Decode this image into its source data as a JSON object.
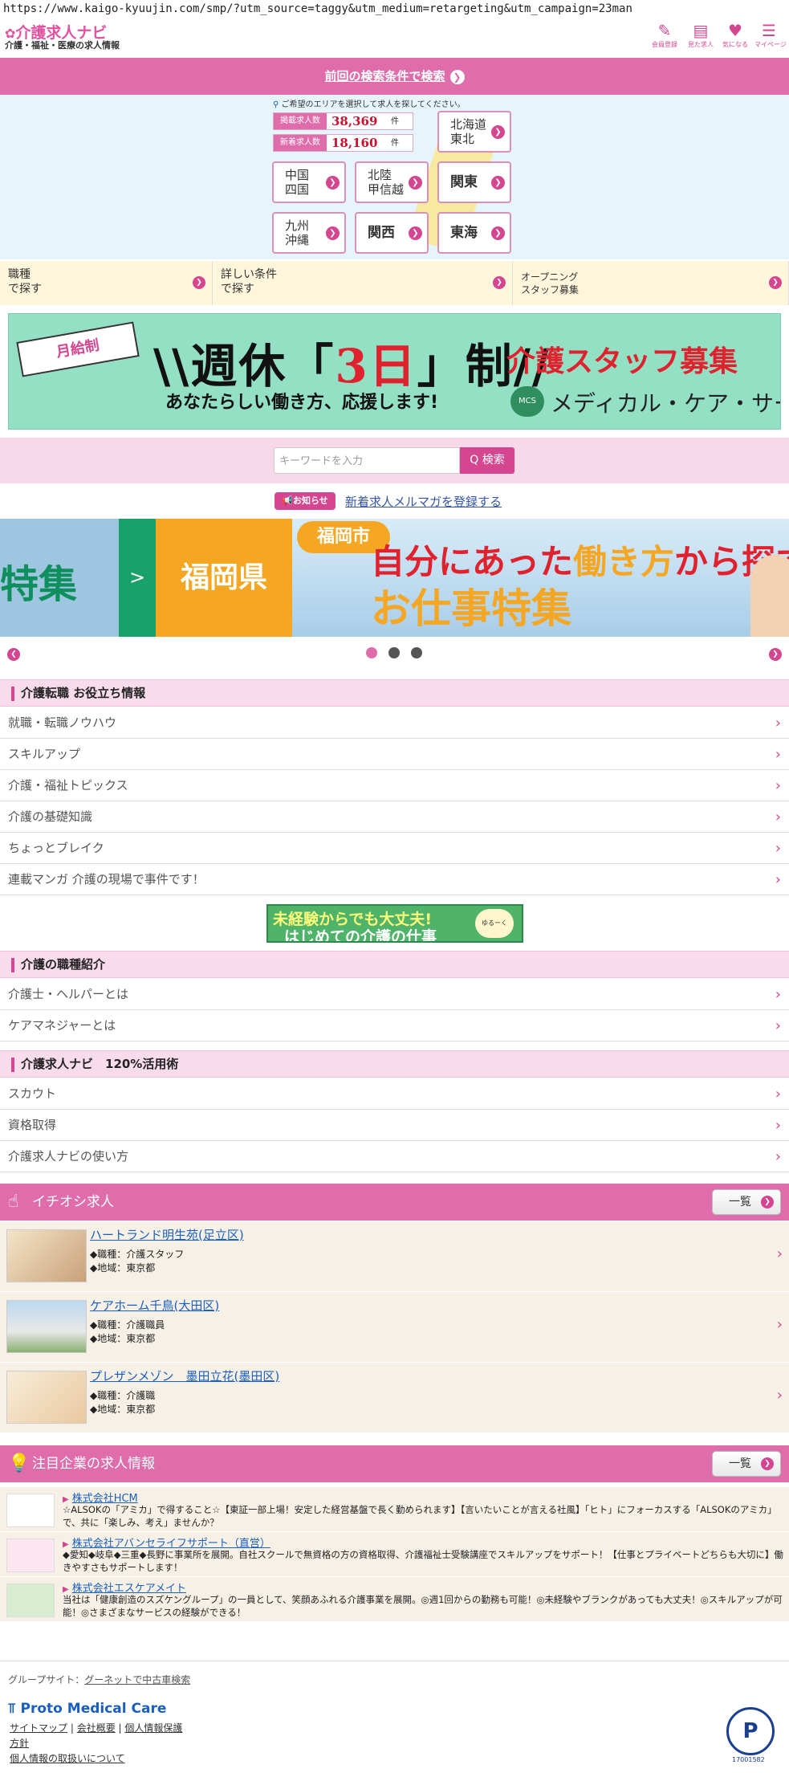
{
  "url": "https://www.kaigo-kyuujin.com/smp/?utm_source=taggy&utm_medium=retargeting&utm_campaign=23man",
  "header": {
    "logo_title": "介護求人ナビ",
    "logo_sub": "介護・福祉・医療の求人情報",
    "icons": [
      {
        "icon": "pencil-icon",
        "label": "会員登録"
      },
      {
        "icon": "history-icon",
        "label": "見た求人"
      },
      {
        "icon": "heart-icon",
        "label": "気になる"
      },
      {
        "icon": "mypage-icon",
        "label": "マイページ"
      }
    ]
  },
  "prev_search": "前回の検索条件で検索",
  "area": {
    "note": "ご希望のエリアを選択して求人を探してください。",
    "stats": [
      {
        "label": "掲載求人数",
        "value": "38,369",
        "unit": "件"
      },
      {
        "label": "新着求人数",
        "value": "18,160",
        "unit": "件"
      }
    ],
    "regions": [
      "北海道\n東北",
      "中国\n四国",
      "北陸\n甲信越",
      "関東",
      "九州\n沖縄",
      "関西",
      "東海"
    ]
  },
  "conditions": [
    "職種\nで探す",
    "詳しい条件\nで探す",
    "オープニング\nスタッフ募集"
  ],
  "banner1": {
    "ribbon": "月給制",
    "main_pre": "\\\\週休「",
    "main_red": "3日",
    "main_post": "」制//",
    "sub": "あなたらしい働き方、応援します!",
    "right_title": "介護スタッフ募集",
    "company": "メディカル・ケア・サービス",
    "logo_text": "MCS"
  },
  "search": {
    "placeholder": "キーワードを入力",
    "button": "検索"
  },
  "news": {
    "tag": "お知らせ",
    "link": "新着求人メルマガを登録する"
  },
  "slider": {
    "left_text": "特集",
    "arrow": ">",
    "pref": "福岡県",
    "city": "福岡市",
    "line1_a": "自分にあった",
    "line1_b": "働き方",
    "line1_c": "から探す",
    "line2": "お仕事特集"
  },
  "info_section": {
    "title": "介護転職 お役立ち情報",
    "items": [
      "就職・転職ノウハウ",
      "スキルアップ",
      "介護・福祉トピックス",
      "介護の基礎知識",
      "ちょっとブレイク",
      "連載マンガ 介護の現場で事件です！"
    ]
  },
  "manga_banner": {
    "line1": "未経験からでも大丈夫!",
    "line2": "はじめての介護の仕事",
    "bubble": "ゆるーく"
  },
  "jobtype_section": {
    "title": "介護の職種紹介",
    "items": [
      "介護士・ヘルパーとは",
      "ケアマネジャーとは"
    ]
  },
  "use_section": {
    "title": "介護求人ナビ　120%活用術",
    "items": [
      "スカウト",
      "資格取得",
      "介護求人ナビの使い方"
    ]
  },
  "pickup": {
    "title": "イチオシ求人",
    "more": "一覧",
    "jobs": [
      {
        "name": "ハートランド明生苑(足立区)",
        "job": "◆職種：介護スタッフ",
        "area": "◆地域：東京都"
      },
      {
        "name": "ケアホーム千鳥(大田区)",
        "job": "◆職種：介護職員",
        "area": "◆地域：東京都"
      },
      {
        "name": "プレザンメゾン　墨田立花(墨田区)",
        "job": "◆職種：介護職",
        "area": "◆地域：東京都"
      }
    ]
  },
  "featured": {
    "title": "注目企業の求人情報",
    "more": "一覧",
    "companies": [
      {
        "name": "株式会社HCM",
        "desc": "☆ALSOKの「アミカ」で得すること☆【東証一部上場！安定した経営基盤で長く勤められます】【言いたいことが言える社風】「ヒト」にフォーカスする「ALSOKのアミカ」で、共に「楽しみ、考え」ませんか？"
      },
      {
        "name": "株式会社アバンセライフサポート（直営）",
        "desc": "◆愛知◆岐阜◆三重◆長野に事業所を展開。自社スクールで無資格の方の資格取得、介護福祉士受験講座でスキルアップをサポート！【仕事とプライベートどちらも大切に】働きやすさもサポートします！"
      },
      {
        "name": "株式会社エスケアメイト",
        "desc": "当社は「健康創造のスズケングループ」の一員として、笑顔あふれる介護事業を展開。◎週1回からの勤務も可能！◎未経験やブランクがあっても大丈夫！◎スキルアップが可能！◎さまざまなサービスの経験ができる！"
      }
    ]
  },
  "footer": {
    "group_label": "グループサイト：",
    "group_link": "グーネットで中古車検索",
    "brand": "Proto Medical Care",
    "links": [
      "サイトマップ",
      "会社概要",
      "個人情報保護"
    ],
    "link_policy": "方針",
    "link_handling": "個人情報の取扱いについて",
    "privacy_num": "17001582"
  },
  "colors": {
    "accent": "#d4468f",
    "pink_bar": "#e06dab",
    "link": "#1a5fbf"
  }
}
